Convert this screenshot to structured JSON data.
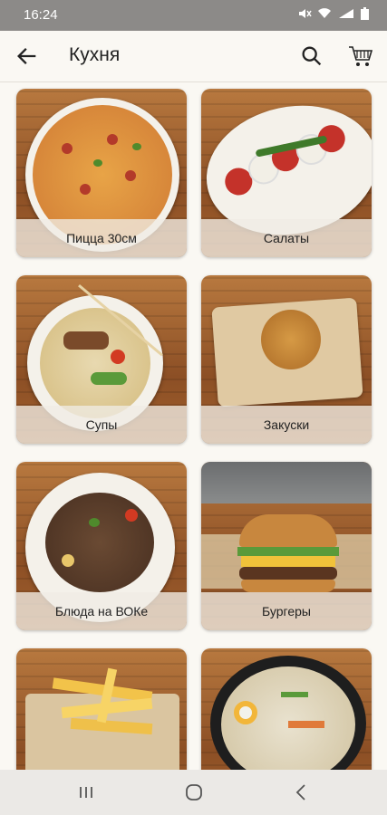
{
  "status": {
    "time": "16:24"
  },
  "appbar": {
    "title": "Кухня"
  },
  "categories": [
    {
      "label": "Пицца 30см"
    },
    {
      "label": "Салаты"
    },
    {
      "label": "Супы"
    },
    {
      "label": "Закуски"
    },
    {
      "label": "Блюда на ВОКе"
    },
    {
      "label": "Бургеры"
    },
    {
      "label": ""
    },
    {
      "label": ""
    }
  ],
  "icons": {
    "back": "arrow-left-icon",
    "search": "search-icon",
    "cart": "shopping-cart-icon",
    "nav_recent": "recent-apps-icon",
    "nav_home": "home-icon",
    "nav_back": "back-icon"
  }
}
